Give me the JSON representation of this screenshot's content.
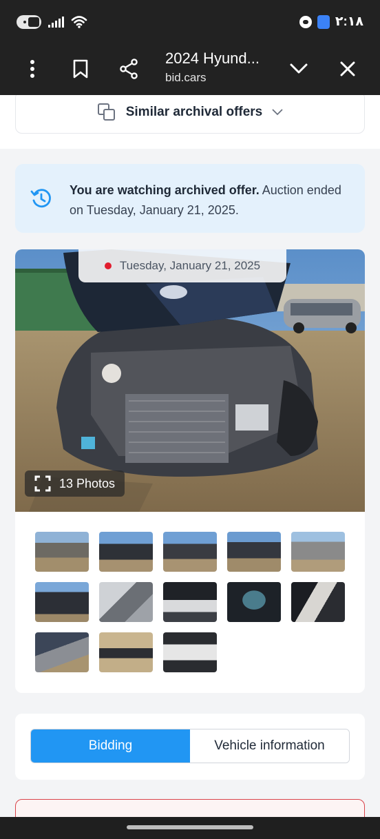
{
  "status_bar": {
    "time": "۲:۱۸"
  },
  "browser": {
    "title": "2024 Hyund...",
    "url": "bid.cars"
  },
  "similar_offers": {
    "label": "Similar archival offers"
  },
  "archived_notice": {
    "bold": "You are watching archived offer.",
    "text": " Auction ended on Tuesday, January 21, 2025."
  },
  "gallery": {
    "date": "Tuesday, January 21, 2025",
    "photos_label": "13 Photos",
    "thumbnail_count": 13
  },
  "tabs": [
    {
      "label": "Bidding",
      "active": true
    },
    {
      "label": "Vehicle information",
      "active": false
    }
  ],
  "colors": {
    "accent": "#2196f3",
    "notice_bg": "#e4f1fc",
    "live_dot": "#e11d2e",
    "alert_border": "#d9434a"
  }
}
